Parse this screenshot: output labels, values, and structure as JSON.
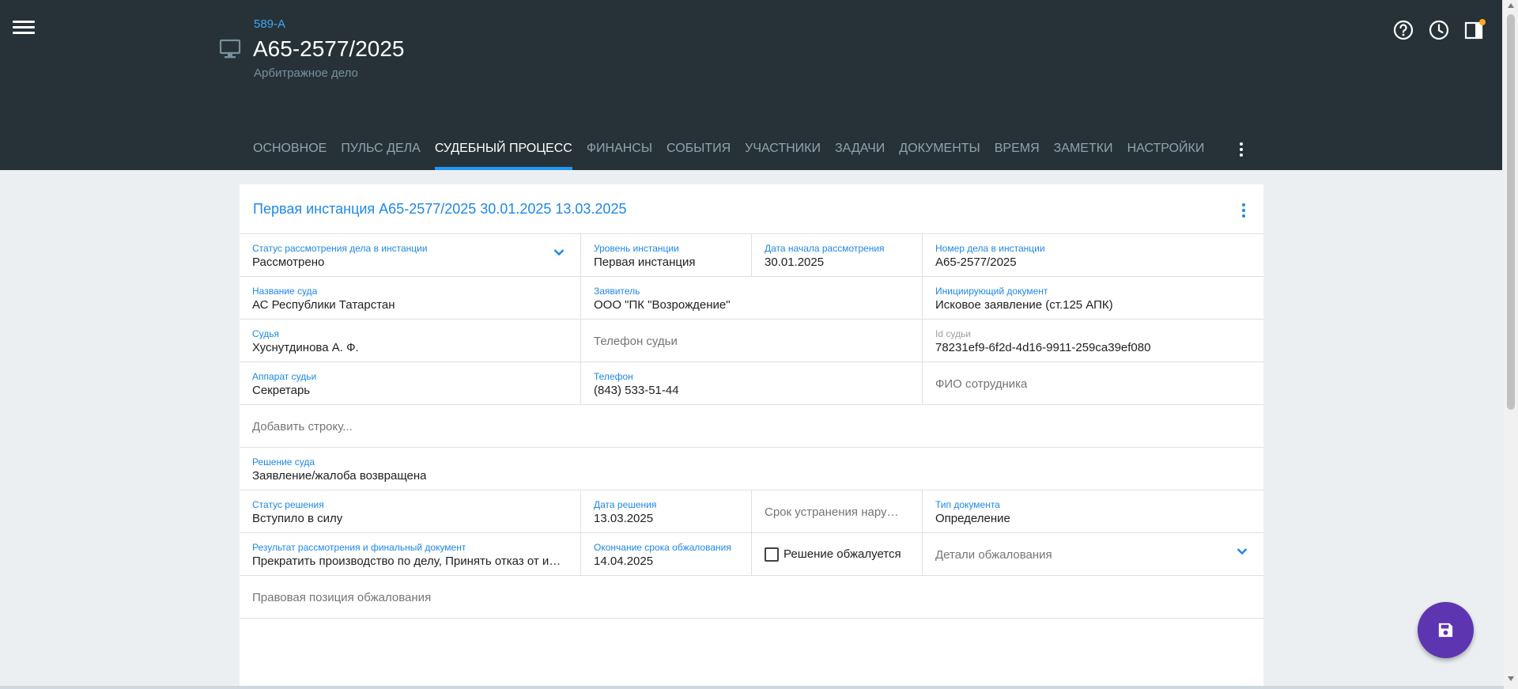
{
  "header": {
    "case_code": "589-А",
    "case_title": "А65-2577/2025",
    "case_subtitle": "Арбитражное дело",
    "icons": [
      "menu-icon",
      "monitor-icon",
      "help-icon",
      "history-icon",
      "panel-icon"
    ],
    "notification_dot_color": "#ffa726"
  },
  "tabs": [
    {
      "label": "ОСНОВНОЕ"
    },
    {
      "label": "ПУЛЬС ДЕЛА"
    },
    {
      "label": "СУДЕБНЫЙ ПРОЦЕСС",
      "active": true
    },
    {
      "label": "ФИНАНСЫ"
    },
    {
      "label": "СОБЫТИЯ"
    },
    {
      "label": "УЧАСТНИКИ"
    },
    {
      "label": "ЗАДАЧИ"
    },
    {
      "label": "ДОКУМЕНТЫ"
    },
    {
      "label": "ВРЕМЯ"
    },
    {
      "label": "ЗАМЕТКИ"
    },
    {
      "label": "НАСТРОЙКИ"
    }
  ],
  "colors": {
    "header_bg": "#263238",
    "accent": "#2196f3",
    "fab": "#5e35b1"
  },
  "card": {
    "title": "Первая инстанция А65-2577/2025 30.01.2025 13.03.2025",
    "fields": {
      "status": {
        "label": "Статус рассмотрения дела в инстанции",
        "value": "Рассмотрено"
      },
      "level": {
        "label": "Уровень инстанции",
        "value": "Первая инстанция"
      },
      "start_date": {
        "label": "Дата начала рассмотрения",
        "value": "30.01.2025"
      },
      "case_number": {
        "label": "Номер дела в инстанции",
        "value": "А65-2577/2025"
      },
      "court": {
        "label": "Название суда",
        "value": "АС Республики Татарстан"
      },
      "applicant": {
        "label": "Заявитель",
        "value": "ООО \"ПК \"Возрождение\""
      },
      "init_doc": {
        "label": "Инициирующий документ",
        "value": "Исковое заявление (ст.125 АПК)"
      },
      "judge": {
        "label": "Судья",
        "value": "Хуснутдинова А. Ф."
      },
      "judge_phone": {
        "placeholder": "Телефон судьи"
      },
      "judge_id": {
        "label": "Id судьи",
        "value": "78231ef9-6f2d-4d16-9911-259ca39ef080"
      },
      "judge_staff": {
        "label": "Аппарат судьи",
        "value": "Секретарь"
      },
      "phone": {
        "label": "Телефон",
        "value": "(843) 533-51-44"
      },
      "employee_name": {
        "placeholder": "ФИО сотрудника"
      },
      "add_row": {
        "placeholder": "Добавить строку..."
      },
      "decision": {
        "label": "Решение суда",
        "value": "Заявление/жалоба возвращена"
      },
      "decision_status": {
        "label": "Статус решения",
        "value": "Вступило в силу"
      },
      "decision_date": {
        "label": "Дата решения",
        "value": "13.03.2025"
      },
      "violation_term": {
        "placeholder": "Срок устранения нарушений"
      },
      "doc_type": {
        "label": "Тип документа",
        "value": "Определение"
      },
      "result": {
        "label": "Результат рассмотрения и финальный документ",
        "value": "Прекратить производство по делу, Принять отказ от иска"
      },
      "appeal_end": {
        "label": "Окончание срока обжалования",
        "value": "14.04.2025"
      },
      "appealed": {
        "label": "Решение обжалуется",
        "checked": false
      },
      "appeal_details": {
        "placeholder": "Детали обжалования"
      },
      "legal_position": {
        "placeholder": "Правовая позиция обжалования"
      }
    }
  }
}
